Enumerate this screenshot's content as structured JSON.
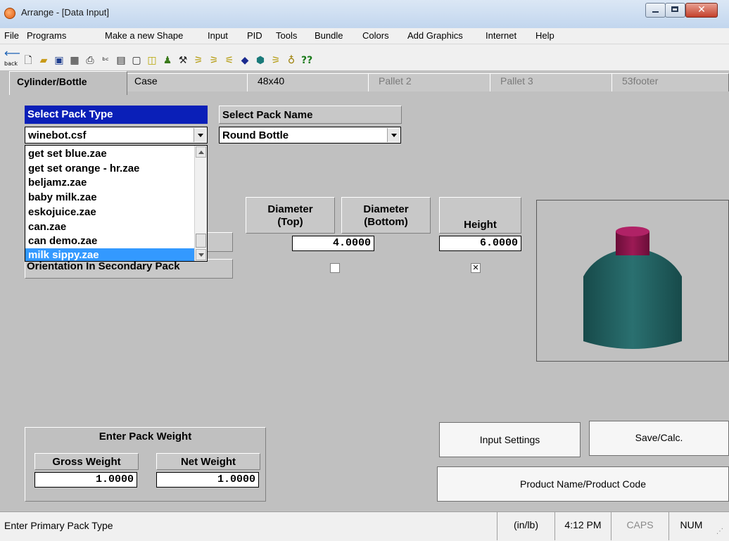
{
  "window": {
    "title": "Arrange - [Data Input]"
  },
  "menu": [
    "File",
    "Programs",
    "Make a new Shape",
    "Input",
    "PID",
    "Tools",
    "Bundle",
    "Colors",
    "Add Graphics",
    "Internet",
    "Help"
  ],
  "toolbar": {
    "back_label": "back"
  },
  "tabs": [
    {
      "label": "Cylinder/Bottle",
      "active": true
    },
    {
      "label": "Case"
    },
    {
      "label": "48x40"
    },
    {
      "label": "Pallet 2",
      "disabled": true
    },
    {
      "label": "Pallet 3",
      "disabled": true
    },
    {
      "label": "53footer",
      "disabled": true
    }
  ],
  "pack_type": {
    "header": "Select Pack Type",
    "selected": "winebot.csf",
    "list": [
      "get set blue.zae",
      "get set orange - hr.zae",
      "beljamz.zae",
      "baby milk.zae",
      "eskojuice.zae",
      "can.zae",
      "can demo.zae",
      "milk sippy.zae"
    ],
    "highlighted": "milk sippy.zae"
  },
  "pack_name": {
    "header": "Select Pack Name",
    "selected": "Round Bottle"
  },
  "dimensions": {
    "diameter_top_label": "Diameter\n(Top)",
    "diameter_bottom_label": "Diameter\n(Bottom)",
    "height_label": "Height",
    "diameter_value": "4.0000",
    "height_value": "6.0000",
    "diameter_checked": false,
    "height_checked": true
  },
  "orientation_label": "Orientation In Secondary Pack",
  "weight": {
    "header": "Enter Pack Weight",
    "gross_label": "Gross Weight",
    "net_label": "Net Weight",
    "gross_value": "1.0000",
    "net_value": "1.0000"
  },
  "buttons": {
    "input_settings": "Input Settings",
    "save_calc": "Save/Calc.",
    "product_name": "Product Name/Product Code"
  },
  "status": {
    "message": "Enter Primary Pack Type",
    "units": "(in/lb)",
    "time": "4:12 PM",
    "caps": "CAPS",
    "num": "NUM"
  },
  "colors": {
    "header_blue": "#0a1fb8",
    "selection_blue": "#3399ff",
    "bottle_body": "#1f5e5e",
    "bottle_cap": "#8a1449"
  }
}
